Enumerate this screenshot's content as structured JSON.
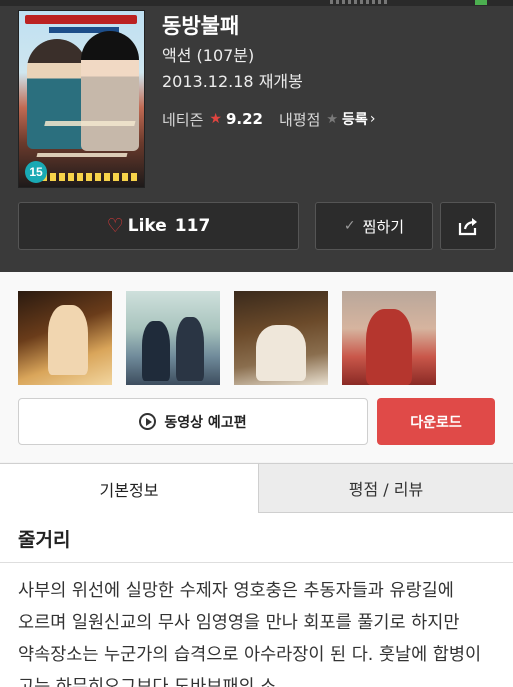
{
  "movie": {
    "title": "동방불패",
    "genre_runtime": "액션 (107분)",
    "rerelease": "2013.12.18 재개봉",
    "age_rating": "15",
    "netizen_label": "네티즌",
    "netizen_score": "9.22",
    "my_rating_label": "내평점",
    "register_label": "등록"
  },
  "actions": {
    "like_label": "Like",
    "like_count": "117",
    "wishlist_label": "찜하기",
    "share_icon": "share-icon"
  },
  "media": {
    "stills_count": 4,
    "trailer_label": "동영상 예고편",
    "download_label": "다운로드"
  },
  "tabs": [
    {
      "label": "기본정보",
      "active": true
    },
    {
      "label": "평점 / 리뷰",
      "active": false
    }
  ],
  "synopsis": {
    "heading": "줄거리",
    "text": "사부의 위선에 실망한 수제자 영호충은 추동자들과 유랑길에 오르며 일원신교의 무사 임영영을 만나 회포를 풀기로 하지만 약속장소는 누군가의 습격으로 아수라장이 된 다. 훗날에 합병이 고는 하무히오그브다 도바브패의 소"
  },
  "colors": {
    "header_bg": "#3a3a3a",
    "accent_red": "#e04a48",
    "star_red": "#e0443f",
    "age_badge": "#19a9b4"
  }
}
